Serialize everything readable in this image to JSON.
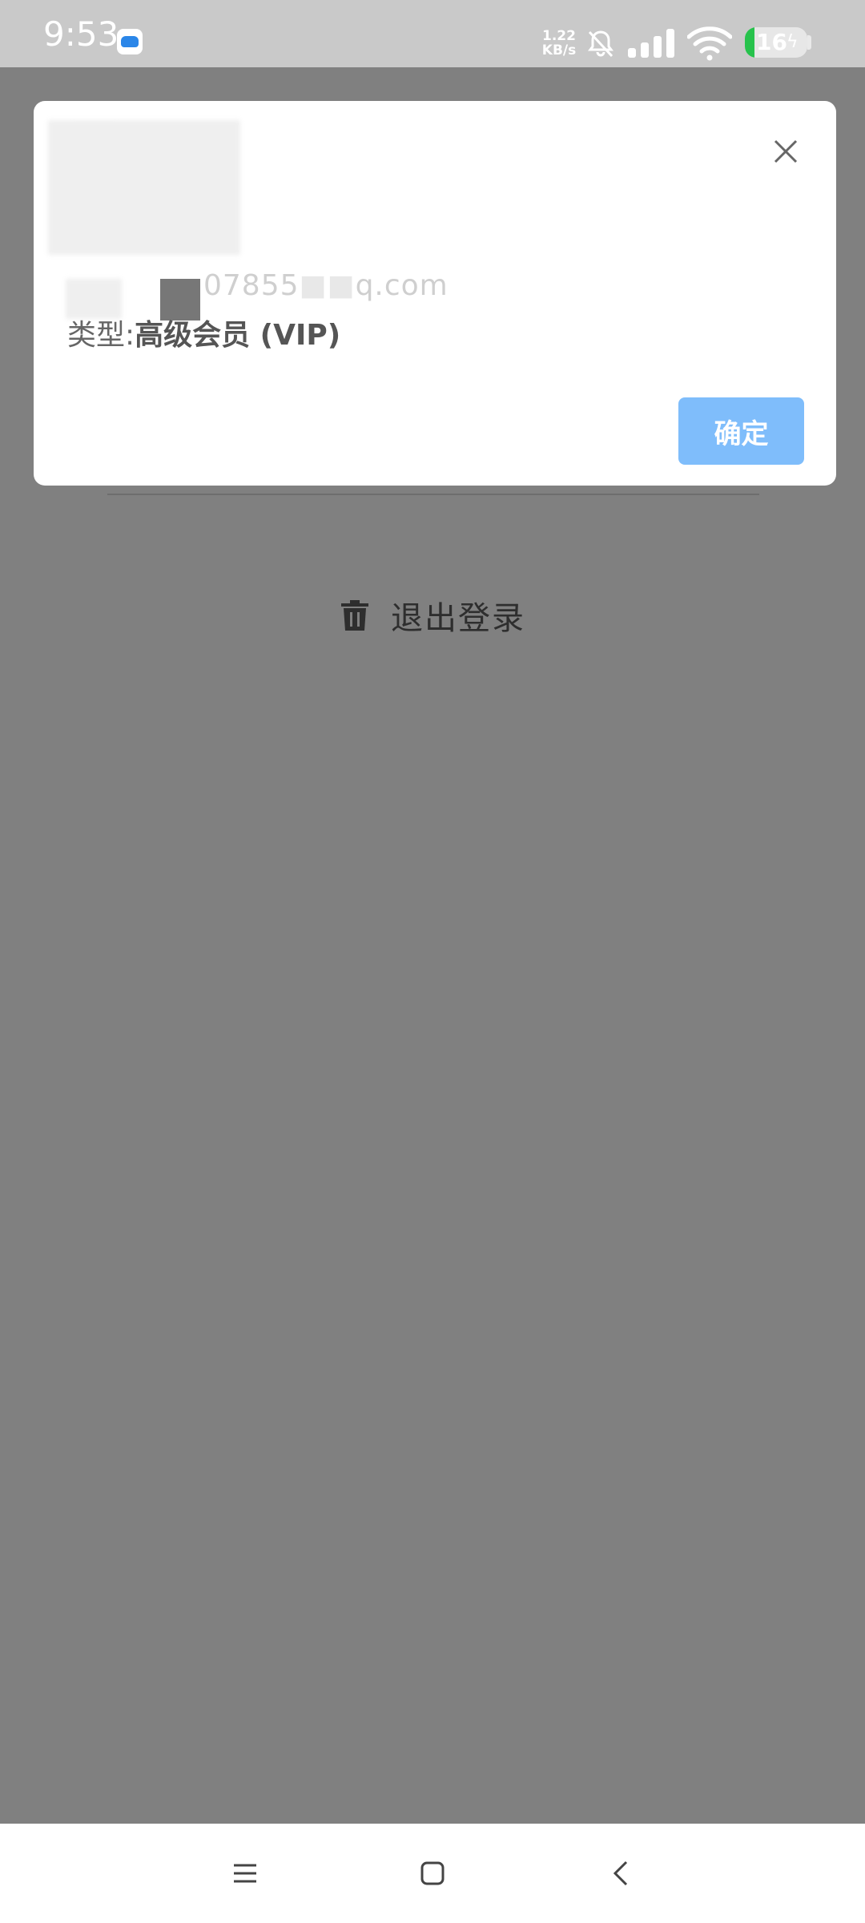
{
  "status_bar": {
    "time": "9:53",
    "net_speed_value": "1.22",
    "net_speed_unit": "KB/s",
    "battery_level": "16",
    "battery_fraction": 0.16,
    "icons": [
      "app-notification-icon",
      "bell-off-icon",
      "signal-icon",
      "wifi-icon",
      "battery-charging-icon"
    ]
  },
  "background_page": {
    "logout_label": "退出登录"
  },
  "dialog": {
    "email_fragment": "07855",
    "email_domain": "q.com",
    "type_label": "类型:",
    "type_value": "高级会员 (VIP)",
    "confirm_label": "确定"
  },
  "colors": {
    "overlay": "#808080",
    "confirm_button": "#7fbdfb",
    "battery_fill": "#27c24c"
  }
}
